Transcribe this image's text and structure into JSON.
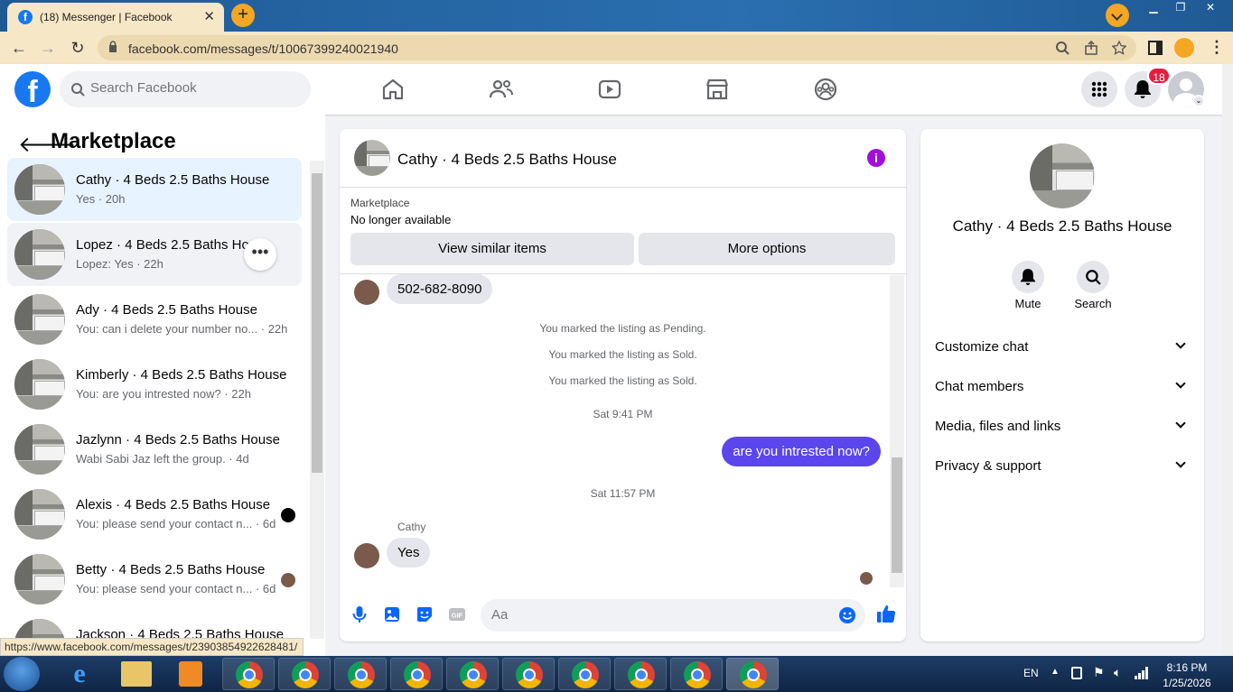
{
  "browser": {
    "tab_title": "(18) Messenger | Facebook",
    "url": "facebook.com/messages/t/10067399240021940",
    "status_url": "https://www.facebook.com/messages/t/23903854922628481/"
  },
  "fb_header": {
    "logo": "f",
    "search_placeholder": "Search Facebook",
    "notification_count": "18",
    "nav_icons": [
      "home-icon",
      "friends-icon",
      "watch-icon",
      "marketplace-icon",
      "groups-icon"
    ]
  },
  "left_panel": {
    "title": "Marketplace",
    "conversations": [
      {
        "name": "Cathy · 4 Beds 2.5 Baths House",
        "snippet": "Yes · 20h"
      },
      {
        "name": "Lopez · 4 Beds 2.5 Baths Hou",
        "snippet": "Lopez: Yes · 22h"
      },
      {
        "name": "Ady · 4 Beds 2.5 Baths House",
        "snippet": "You: can i delete your number no... · 22h"
      },
      {
        "name": "Kimberly · 4 Beds 2.5 Baths House",
        "snippet": "You: are you intrested now? · 22h"
      },
      {
        "name": "Jazlynn · 4 Beds 2.5 Baths House",
        "snippet": "Wabi Sabi Jaz left the group. · 4d"
      },
      {
        "name": "Alexis · 4 Beds 2.5 Baths House",
        "snippet": "You: please send your contact n... · 6d"
      },
      {
        "name": "Betty · 4 Beds 2.5 Baths House",
        "snippet": "You: please send your contact n... · 6d"
      },
      {
        "name": "Jackson · 4 Beds 2.5 Baths House",
        "snippet": ""
      }
    ]
  },
  "chat": {
    "title": "Cathy · 4 Beds 2.5 Baths House",
    "marketplace_label": "Marketplace",
    "listing_status": "No longer available",
    "view_similar": "View similar items",
    "more_options": "More options",
    "messages": {
      "phone": "502-682-8090",
      "sys1": "You marked the listing as Pending.",
      "sys2": "You marked the listing as Sold.",
      "sys3": "You marked the listing as Sold.",
      "time1": "Sat 9:41 PM",
      "outgoing": "are you intrested now?",
      "time2": "Sat 11:57 PM",
      "sender": "Cathy",
      "reply": "Yes"
    },
    "composer_placeholder": "Aa"
  },
  "right_panel": {
    "name": "Cathy · 4 Beds 2.5 Baths House",
    "mute": "Mute",
    "search": "Search",
    "sections": [
      "Customize chat",
      "Chat members",
      "Media, files and links",
      "Privacy & support"
    ]
  },
  "taskbar": {
    "lang": "EN",
    "time": "8:16 PM",
    "date": "1/25/2026"
  },
  "colors": {
    "fb_blue": "#1877f2",
    "outgoing_bubble": "#5b45ec",
    "notification_red": "#e41e3f"
  }
}
